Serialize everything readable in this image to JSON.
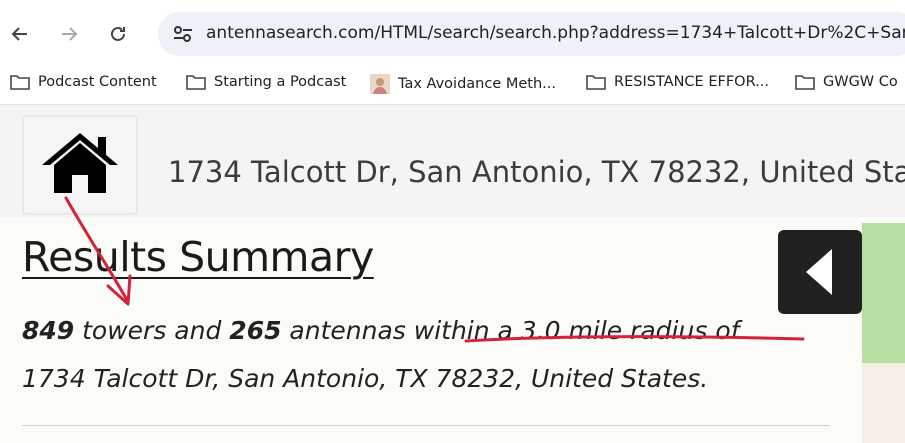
{
  "browser": {
    "url": "antennasearch.com/HTML/search/search.php?address=1734+Talcott+Dr%2C+San+",
    "icons": {
      "back": "back-arrow-icon",
      "forward": "forward-arrow-icon",
      "reload": "reload-icon",
      "site_info": "tune-icon"
    }
  },
  "bookmarks": [
    {
      "label": "Podcast Content",
      "icon": "folder-icon"
    },
    {
      "label": "Starting a Podcast",
      "icon": "folder-icon"
    },
    {
      "label": "Tax Avoidance Meth...",
      "icon": "profile-image-icon"
    },
    {
      "label": "RESISTANCE EFFOR...",
      "icon": "folder-icon"
    },
    {
      "label": "GWGW Co",
      "icon": "folder-icon"
    }
  ],
  "page": {
    "header_address": "1734 Talcott Dr, San Antonio, TX  78232, United Stat",
    "results_title": "Results Summary",
    "towers_count": "849",
    "towers_text": " towers and ",
    "antennas_count": "265",
    "antennas_text": " antennas ",
    "radius_text": "within a 3.0 mile radius",
    "of_text": " of",
    "address_line": "1734 Talcott Dr, San Antonio, TX 78232, United States."
  },
  "colors": {
    "annotation_red": "#d2233a",
    "green_panel": "#b8dda0",
    "dark_button": "#212121"
  }
}
